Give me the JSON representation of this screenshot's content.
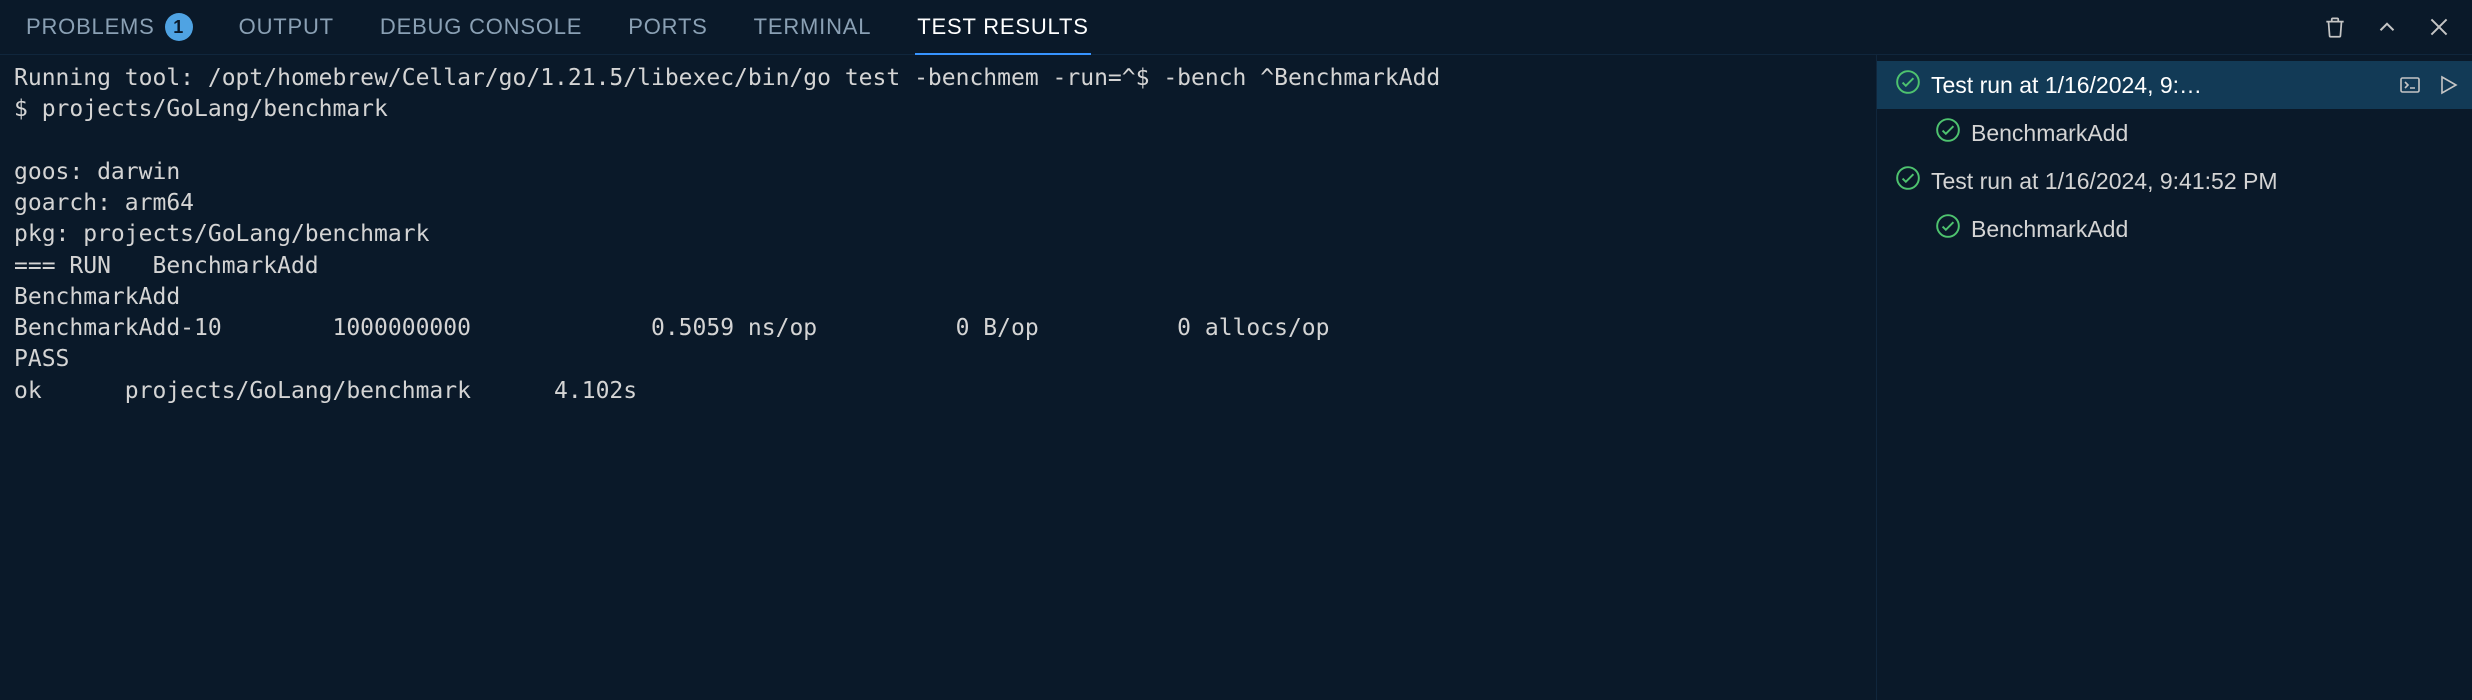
{
  "tabs": {
    "problems": {
      "label": "PROBLEMS",
      "badge": "1"
    },
    "output": {
      "label": "OUTPUT"
    },
    "debug_console": {
      "label": "DEBUG CONSOLE"
    },
    "ports": {
      "label": "PORTS"
    },
    "terminal": {
      "label": "TERMINAL"
    },
    "test_results": {
      "label": "TEST RESULTS"
    }
  },
  "output_text": "Running tool: /opt/homebrew/Cellar/go/1.21.5/libexec/bin/go test -benchmem -run=^$ -bench ^BenchmarkAdd\n$ projects/GoLang/benchmark\n\ngoos: darwin\ngoarch: arm64\npkg: projects/GoLang/benchmark\n=== RUN   BenchmarkAdd\nBenchmarkAdd\nBenchmarkAdd-10        1000000000             0.5059 ns/op          0 B/op          0 allocs/op\nPASS\nok      projects/GoLang/benchmark      4.102s",
  "tree": {
    "run1": {
      "label": "Test run at 1/16/2024, 9:…",
      "child": "BenchmarkAdd"
    },
    "run2": {
      "label": "Test run at 1/16/2024, 9:41:52 PM",
      "child": "BenchmarkAdd"
    }
  },
  "colors": {
    "pass": "#4EC36F",
    "accent": "#3794ff"
  }
}
